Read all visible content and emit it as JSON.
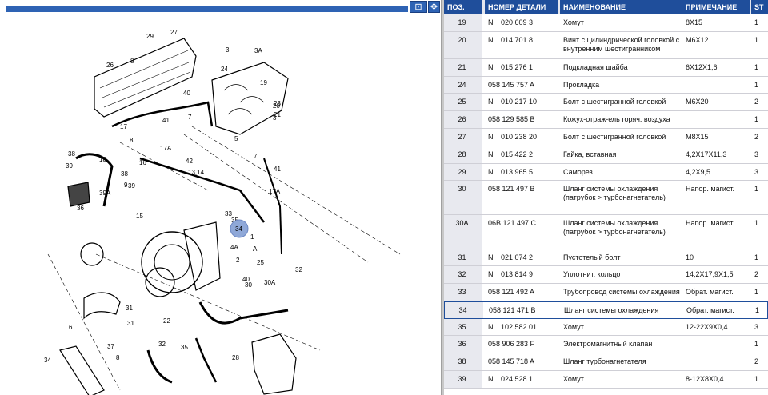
{
  "toolbar": {
    "left_btn": "⇦",
    "right_btn": "⇨",
    "box_icon": "⊡"
  },
  "diagram": {
    "labels": [
      "29",
      "27",
      "3",
      "3A",
      "26",
      "8",
      "24",
      "19",
      "40",
      "23",
      "3",
      "17",
      "20",
      "21",
      "41",
      "7",
      "5",
      "17A",
      "7",
      "38",
      "42",
      "41",
      "39",
      "13,14",
      "18",
      "16",
      "8",
      "17A",
      "9",
      "38",
      "39A",
      "39",
      "36",
      "15",
      "35",
      "33",
      "34",
      "1",
      "4A",
      "A",
      "2",
      "25",
      "40",
      "30",
      "30A",
      "32",
      "31",
      "31",
      "22",
      "32",
      "6",
      "37",
      "35",
      "8",
      "28",
      "34"
    ],
    "callout_selected": "34"
  },
  "table": {
    "headers": [
      "ПОЗ.",
      "НОМЕР ДЕТАЛИ",
      "НАИМЕНОВАНИЕ",
      "ПРИМЕЧАНИЕ",
      "ST"
    ],
    "rows": [
      {
        "pos": "19",
        "n": "N",
        "num": "020  609  3",
        "name": "Хомут",
        "note": "8X15",
        "st": "1"
      },
      {
        "pos": "20",
        "n": "N",
        "num": "014  701  8",
        "name": "Винт с цилиндрической головкой с внутренним шестигранником",
        "note": "M6X12",
        "st": "1"
      },
      {
        "pos": "21",
        "n": "N",
        "num": "015  276  1",
        "name": "Подкладная шайба",
        "note": "6X12X1,6",
        "st": "1"
      },
      {
        "pos": "24",
        "n": "",
        "num": "058  145  757  A",
        "name": "Прокладка",
        "note": "",
        "st": "1"
      },
      {
        "pos": "25",
        "n": "N",
        "num": "010  217  10",
        "name": "Болт с шестигранной головкой",
        "note": "M6X20",
        "st": "2"
      },
      {
        "pos": "26",
        "n": "",
        "num": "058  129  585  B",
        "name": "Кожух-отраж-ель горяч. воздуха",
        "note": "",
        "st": "1"
      },
      {
        "pos": "27",
        "n": "N",
        "num": "010  238  20",
        "name": "Болт с шестигранной головкой",
        "note": "M8X15",
        "st": "2"
      },
      {
        "pos": "28",
        "n": "N",
        "num": "015  422  2",
        "name": "Гайка, вставная",
        "note": "4,2X17X11,3",
        "st": "3"
      },
      {
        "pos": "29",
        "n": "N",
        "num": "013  965  5",
        "name": "Саморез",
        "note": "4,2X9,5",
        "st": "3"
      },
      {
        "pos": "30",
        "n": "",
        "num": "058  121  497  B",
        "name": "Шланг системы охлаждения (патрубок > турбонагнетатель)",
        "note": "Напор. магист.",
        "st": "1"
      },
      {
        "pos": "30A",
        "n": "",
        "num": "06B  121  497  C",
        "name": "Шланг системы охлаждения (патрубок > турбонагнетатель)",
        "note": "Напор. магист.",
        "st": "1"
      },
      {
        "pos": "31",
        "n": "N",
        "num": "021  074  2",
        "name": "Пустотелый болт",
        "note": "10",
        "st": "1"
      },
      {
        "pos": "32",
        "n": "N",
        "num": "013  814  9",
        "name": "Уплотнит. кольцо",
        "note": "14,2X17,9X1,5",
        "st": "2"
      },
      {
        "pos": "33",
        "n": "",
        "num": "058  121  492  A",
        "name": "Трубопровод системы охлаждения",
        "note": "Обрат. магист.",
        "st": "1"
      },
      {
        "pos": "34",
        "n": "",
        "num": "058  121  471  B",
        "name": "Шланг системы охлаждения",
        "note": "Обрат. магист.",
        "st": "1",
        "selected": true
      },
      {
        "pos": "35",
        "n": "N",
        "num": "102  582  01",
        "name": "Хомут",
        "note": "12-22X9X0,4",
        "st": "3"
      },
      {
        "pos": "36",
        "n": "",
        "num": "058  906  283  F",
        "name": "Электромагнитный клапан",
        "note": "",
        "st": "1"
      },
      {
        "pos": "38",
        "n": "",
        "num": "058  145  718  A",
        "name": "Шланг турбонагнетателя",
        "note": "",
        "st": "2"
      },
      {
        "pos": "39",
        "n": "N",
        "num": "024  528  1",
        "name": "Хомут",
        "note": "8-12X8X0,4",
        "st": "1"
      }
    ]
  }
}
